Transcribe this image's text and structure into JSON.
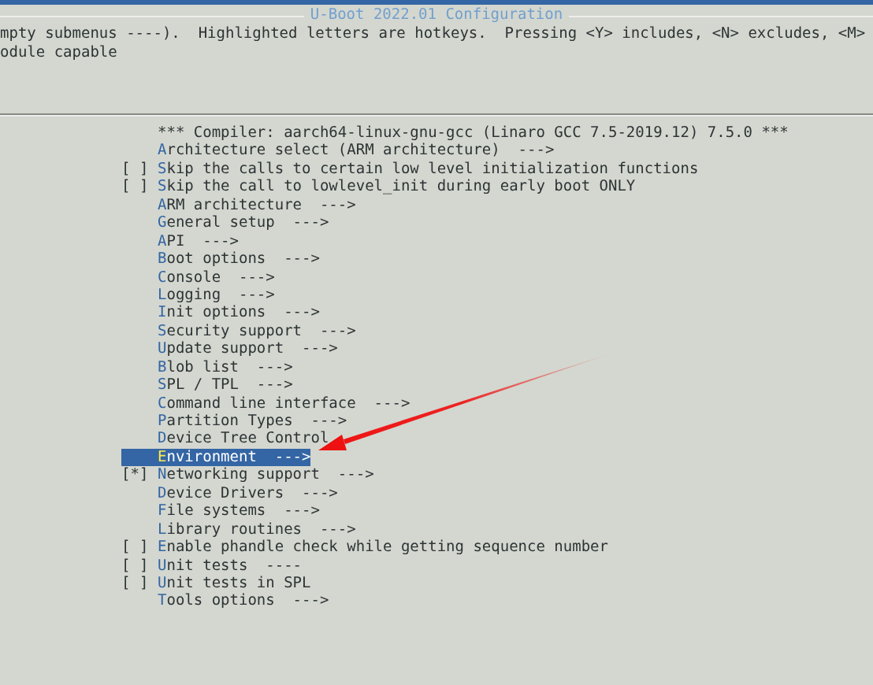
{
  "window": {
    "title": "U-Boot 2022.01 Configuration"
  },
  "help_text": [
    "mpty submenus ----).  Highlighted letters are hotkeys.  Pressing <Y> includes, <N> excludes, <M>",
    "odule capable"
  ],
  "menu": [
    {
      "kind": "comment",
      "label": "*** Compiler: aarch64-linux-gnu-gcc (Linaro GCC 7.5-2019.12) 7.5.0 ***",
      "selected": false
    },
    {
      "kind": "menu",
      "label": "Architecture select (ARM architecture)  --->",
      "selected": false
    },
    {
      "kind": "checkbox",
      "box": "[ ]",
      "label": "Skip the calls to certain low level initialization functions",
      "selected": false
    },
    {
      "kind": "checkbox",
      "box": "[ ]",
      "label": "Skip the call to lowlevel_init during early boot ONLY",
      "selected": false
    },
    {
      "kind": "menu",
      "label": "ARM architecture  --->",
      "selected": false
    },
    {
      "kind": "menu",
      "label": "General setup  --->",
      "selected": false
    },
    {
      "kind": "menu",
      "label": "API  --->",
      "selected": false
    },
    {
      "kind": "menu",
      "label": "Boot options  --->",
      "selected": false
    },
    {
      "kind": "menu",
      "label": "Console  --->",
      "selected": false
    },
    {
      "kind": "menu",
      "label": "Logging  --->",
      "selected": false
    },
    {
      "kind": "menu",
      "label": "Init options  --->",
      "selected": false
    },
    {
      "kind": "menu",
      "label": "Security support  --->",
      "selected": false
    },
    {
      "kind": "menu",
      "label": "Update support  --->",
      "selected": false
    },
    {
      "kind": "menu",
      "label": "Blob list  --->",
      "selected": false
    },
    {
      "kind": "menu",
      "label": "SPL / TPL  --->",
      "selected": false
    },
    {
      "kind": "menu",
      "label": "Command line interface  --->",
      "selected": false
    },
    {
      "kind": "menu",
      "label": "Partition Types  --->",
      "selected": false
    },
    {
      "kind": "menu",
      "label": "Device Tree Control",
      "selected": false
    },
    {
      "kind": "menu",
      "label": "Environment  --->",
      "selected": true
    },
    {
      "kind": "checkbox",
      "box": "[*]",
      "label": "Networking support  --->",
      "selected": false
    },
    {
      "kind": "menu",
      "label": "Device Drivers  --->",
      "selected": false
    },
    {
      "kind": "menu",
      "label": "File systems  --->",
      "selected": false
    },
    {
      "kind": "menu",
      "label": "Library routines  --->",
      "selected": false
    },
    {
      "kind": "checkbox",
      "box": "[ ]",
      "label": "Enable phandle check while getting sequence number",
      "selected": false
    },
    {
      "kind": "checkbox",
      "box": "[ ]",
      "label": "Unit tests  ----",
      "selected": false
    },
    {
      "kind": "checkbox",
      "box": "[ ]",
      "label": "Unit tests in SPL",
      "selected": false
    },
    {
      "kind": "menu",
      "label": "Tools options  --->",
      "selected": false
    }
  ]
}
